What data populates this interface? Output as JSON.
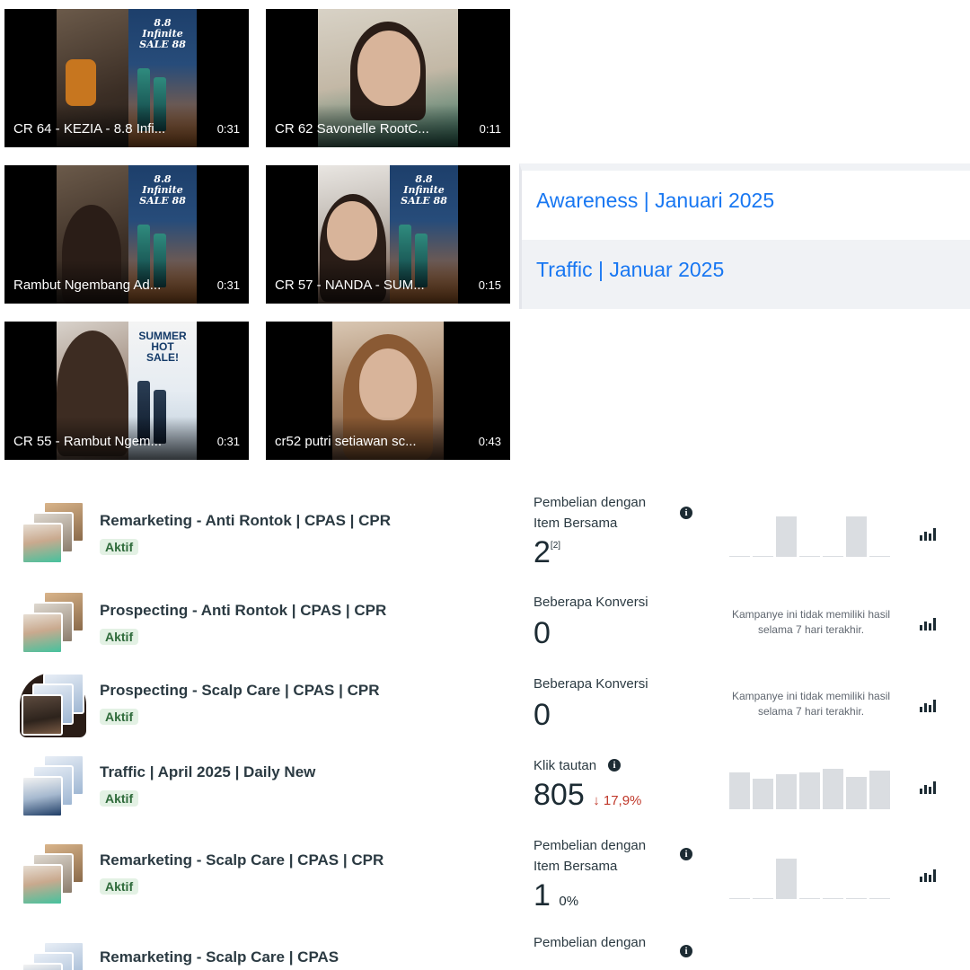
{
  "videos": [
    {
      "title": "CR 64 - KEZIA - 8.8 Infi...",
      "duration": "0:31",
      "promo": "8.8 Infinite SALE 88"
    },
    {
      "title": "CR 62 Savonelle RootC...",
      "duration": "0:11",
      "promo": ""
    },
    {
      "title": "Rambut Ngembang Ad...",
      "duration": "0:31",
      "promo": "8.8 Infinite SALE 88"
    },
    {
      "title": "CR 57 - NANDA - SUM...",
      "duration": "0:15",
      "promo": "8.8 Infinite SALE 88"
    },
    {
      "title": "CR 55 - Rambut Ngem...",
      "duration": "0:31",
      "promo": "SUMMER HOT SALE!"
    },
    {
      "title": "cr52 putri setiawan sc...",
      "duration": "0:43",
      "promo": ""
    }
  ],
  "campaigns": [
    {
      "label": "Awareness | Januari 2025"
    },
    {
      "label": "Traffic | Januar 2025"
    }
  ],
  "ads": [
    {
      "name": "Remarketing - Anti Rontok | CPAS | CPR",
      "status": "Aktif",
      "metric_label": "Pembelian dengan Item Bersama",
      "value": "2",
      "note": "[2]",
      "sparkline": [
        0,
        0,
        0.8,
        0,
        0,
        0.8,
        0
      ],
      "no_results": ""
    },
    {
      "name": "Prospecting - Anti Rontok | CPAS | CPR",
      "status": "Aktif",
      "metric_label": "Beberapa Konversi",
      "value": "0",
      "no_results": "Kampanye ini tidak memiliki hasil selama 7 hari terakhir."
    },
    {
      "name": "Prospecting - Scalp Care | CPAS | CPR",
      "status": "Aktif",
      "metric_label": "Beberapa Konversi",
      "value": "0",
      "no_results": "Kampanye ini tidak memiliki hasil selama 7 hari terakhir."
    },
    {
      "name": "Traffic | April 2025 | Daily New",
      "status": "Aktif",
      "metric_label": "Klik tautan",
      "value": "805",
      "change": "↓ 17,9%",
      "sparkline": [
        0.73,
        0.6,
        0.7,
        0.73,
        0.8,
        0.65,
        0.77
      ],
      "no_results": ""
    },
    {
      "name": "Remarketing - Scalp Care | CPAS | CPR",
      "status": "Aktif",
      "metric_label": "Pembelian dengan Item Bersama",
      "value": "1",
      "change": "0%",
      "sparkline": [
        0,
        0,
        0.8,
        0,
        0,
        0,
        0
      ],
      "no_results": ""
    },
    {
      "name": "Remarketing - Scalp Care | CPAS",
      "status": "",
      "metric_label": "Pembelian dengan",
      "value": "",
      "no_results": ""
    }
  ],
  "icons": {
    "info": "info-icon",
    "chart": "bar-chart-icon"
  },
  "colors": {
    "link": "#1877f2",
    "active_badge_bg": "#e3f1e4",
    "active_badge_text": "#2f6b3b",
    "decrease": "#c0392b"
  }
}
